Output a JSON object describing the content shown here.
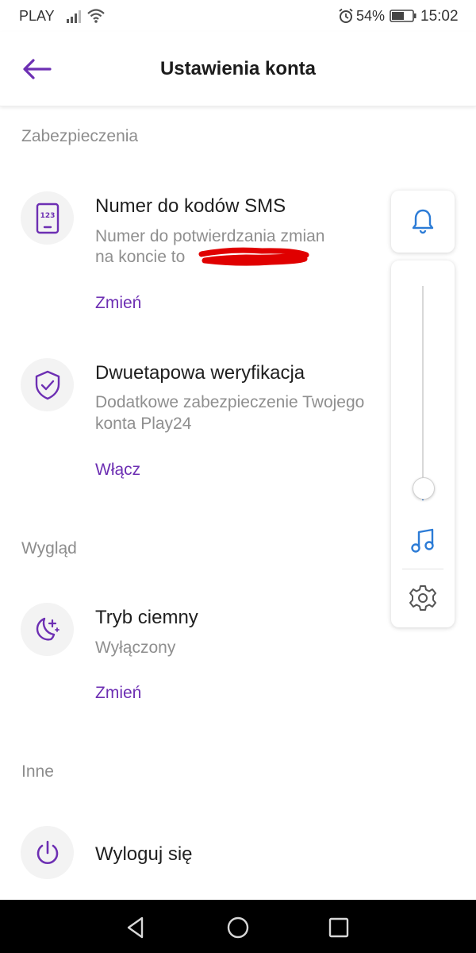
{
  "status_bar": {
    "carrier": "PLAY",
    "battery_percent": "54%",
    "time": "15:02",
    "icons": [
      "signal-icon",
      "wifi-icon",
      "alarm-icon",
      "battery-icon"
    ]
  },
  "app_bar": {
    "title": "Ustawienia konta",
    "back_icon": "arrow-left-icon"
  },
  "colors": {
    "accent": "#6d2fb3",
    "section_title": "#8d8d8d",
    "subtitle": "#8f8f8f",
    "volume_accent": "#2b7bd6",
    "redaction": "#e00000"
  },
  "sections": {
    "security": {
      "title": "Zabezpieczenia",
      "sms": {
        "icon": "phone-123-icon",
        "title": "Numer do kodów SMS",
        "subtitle_line1": "Numer do potwierdzania zmian",
        "subtitle_line2": "na koncie to",
        "action": "Zmień"
      },
      "two_step": {
        "icon": "shield-check-icon",
        "title": "Dwuetapowa weryfikacja",
        "subtitle_line1": "Dodatkowe zabezpieczenie Twojego",
        "subtitle_line2": "konta Play24",
        "action": "Włącz"
      }
    },
    "appearance": {
      "title": "Wygląd",
      "dark_mode": {
        "icon": "moon-stars-icon",
        "title": "Tryb ciemny",
        "subtitle": "Wyłączony",
        "action": "Zmień"
      }
    },
    "other": {
      "title": "Inne",
      "logout": {
        "icon": "power-icon",
        "title": "Wyloguj się"
      }
    }
  },
  "volume_overlay": {
    "icons": [
      "bell-icon",
      "music-note-icon",
      "gear-icon"
    ],
    "level_fraction": 0.06
  },
  "nav_bar": {
    "icons": [
      "back-triangle-icon",
      "home-circle-icon",
      "recents-square-icon"
    ]
  }
}
